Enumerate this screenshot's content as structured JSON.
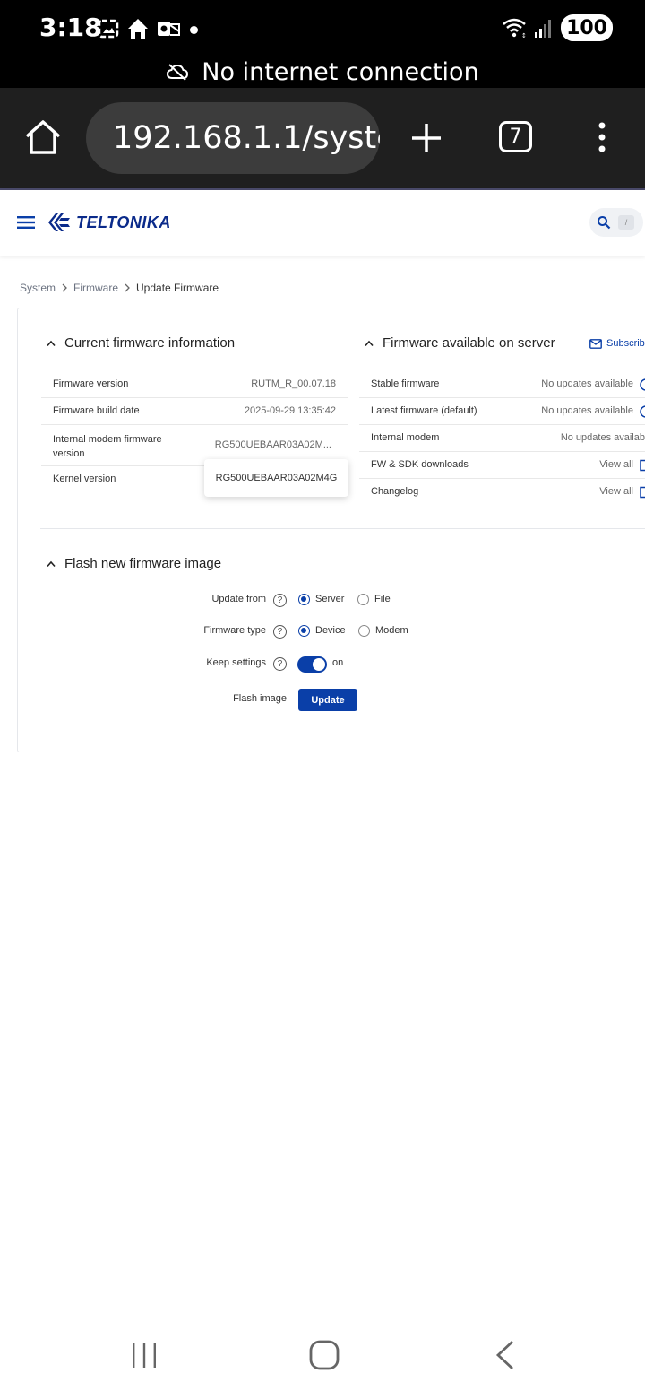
{
  "status_bar": {
    "time": "3:18",
    "battery": "100"
  },
  "network_banner": {
    "text": "No internet connection"
  },
  "browser": {
    "url": "192.168.1.1/syste",
    "tab_count": "7"
  },
  "header": {
    "brand": "TELTONIKA",
    "search_shortcut": "/"
  },
  "breadcrumb": {
    "items": [
      "System",
      "Firmware",
      "Update Firmware"
    ]
  },
  "current_firmware": {
    "title": "Current firmware information",
    "rows": [
      {
        "label": "Firmware version",
        "value": "RUTM_R_00.07.18"
      },
      {
        "label": "Firmware build date",
        "value": "2025-09-29 13:35:42"
      },
      {
        "label": "Internal modem firmware version",
        "value": "RG500UEBAAR03A02M..."
      },
      {
        "label": "Kernel version",
        "value": ""
      }
    ],
    "tooltip": "RG500UEBAAR03A02M4G"
  },
  "server_firmware": {
    "title": "Firmware available on server",
    "subscribe_label": "Subscrib",
    "rows": [
      {
        "label": "Stable firmware",
        "value": "No updates available"
      },
      {
        "label": "Latest firmware (default)",
        "value": "No updates available"
      },
      {
        "label": "Internal modem",
        "value": "No updates availab"
      },
      {
        "label": "FW & SDK downloads",
        "value": "View all"
      },
      {
        "label": "Changelog",
        "value": "View all"
      }
    ]
  },
  "flash": {
    "title": "Flash new firmware image",
    "update_from": {
      "label": "Update from",
      "options": [
        "Server",
        "File"
      ],
      "selected": "Server"
    },
    "firmware_type": {
      "label": "Firmware type",
      "options": [
        "Device",
        "Modem"
      ],
      "selected": "Device"
    },
    "keep_settings": {
      "label": "Keep settings",
      "state": "on"
    },
    "flash_image": {
      "label": "Flash image",
      "button": "Update"
    },
    "help_glyph": "?"
  },
  "colors": {
    "accent": "#0a3fa8",
    "brand": "#0a2a8a"
  }
}
